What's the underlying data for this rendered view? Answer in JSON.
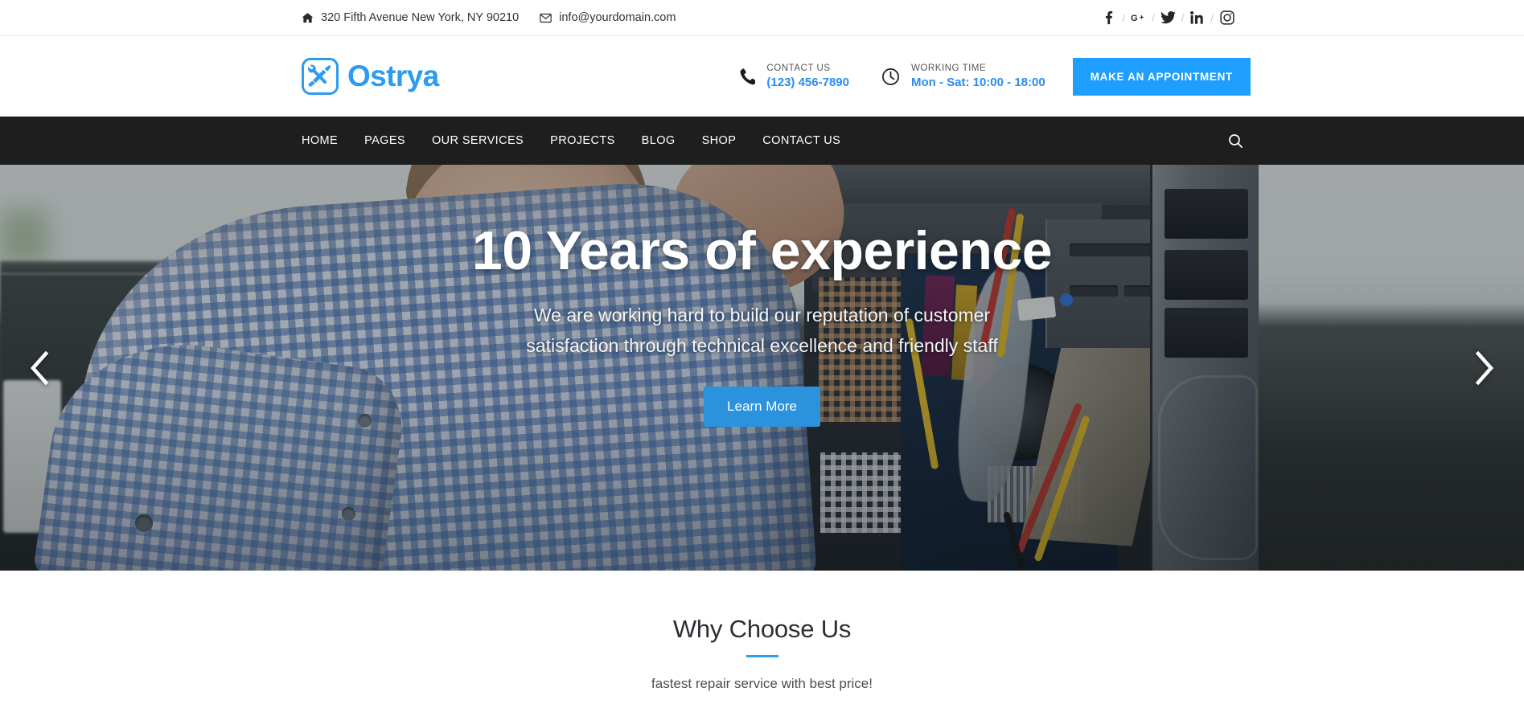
{
  "topbar": {
    "address": "320 Fifth Avenue New York, NY 90210",
    "email": "info@yourdomain.com",
    "address_icon": "home-icon",
    "email_icon": "envelope-icon",
    "separator": "/",
    "socials": [
      {
        "name": "facebook-icon",
        "label": "f"
      },
      {
        "name": "google-plus-icon",
        "label": "G+"
      },
      {
        "name": "twitter-icon",
        "label": "Twitter"
      },
      {
        "name": "linkedin-icon",
        "label": "in"
      },
      {
        "name": "instagram-icon",
        "label": "Instagram"
      }
    ]
  },
  "header": {
    "logo_text": "Ostrya",
    "logo_icon": "wrench-screwdriver-icon",
    "contact": {
      "icon": "phone-icon",
      "label": "CONTACT US",
      "value": "(123) 456-7890"
    },
    "working_time": {
      "icon": "clock-icon",
      "label": "WORKING TIME",
      "value": "Mon - Sat: 10:00 - 18:00"
    },
    "appointment_button": "MAKE AN APPOINTMENT"
  },
  "nav": {
    "items": [
      {
        "label": "HOME"
      },
      {
        "label": "PAGES"
      },
      {
        "label": "OUR SERVICES"
      },
      {
        "label": "PROJECTS"
      },
      {
        "label": "BLOG"
      },
      {
        "label": "SHOP"
      },
      {
        "label": "CONTACT US"
      }
    ],
    "search_icon": "search-icon"
  },
  "hero": {
    "title": "10 Years of experience",
    "subtitle": "We are working hard to build our reputation of customer satisfaction through technical excellence and friendly staff",
    "button": "Learn More",
    "prev_icon": "chevron-left-icon",
    "next_icon": "chevron-right-icon"
  },
  "why": {
    "title": "Why Choose Us",
    "subtitle": "fastest repair service with best price!"
  },
  "colors": {
    "brand_blue": "#2b9cf0",
    "button_blue": "#1e9eff",
    "hero_button_blue": "#2b92dd",
    "nav_dark": "#1e1e1e",
    "accent_rule": "#2b9cf0"
  }
}
